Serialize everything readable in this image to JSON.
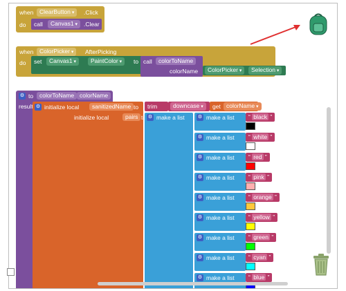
{
  "clear_event": {
    "when": "when",
    "component": "ClearButton",
    "event": ".Click",
    "do": "do",
    "call": "call",
    "target": "Canvas1",
    "method": ".Clear"
  },
  "picker_event": {
    "when": "when",
    "component": "ColorPicker",
    "event": "AfterPicking",
    "do": "do",
    "set": "set",
    "target": "Canvas1",
    "property": "PaintColor",
    "to": "to",
    "call": "call",
    "proc": "colorToName",
    "param": "colorName",
    "source": "ColorPicker",
    "source_prop": "Selection"
  },
  "proc": {
    "to": "to",
    "name": "colorToName",
    "arg": "colorName",
    "result": "result"
  },
  "init1": {
    "label": "initialize local",
    "var": "sanitizedName",
    "to": "to",
    "trim": "trim",
    "case": "downcase",
    "get": "get",
    "get_var": "colorName"
  },
  "init2": {
    "label": "initialize local",
    "var": "pairs",
    "to": "to"
  },
  "list": {
    "make_a_list": "make a list"
  },
  "colors": [
    {
      "name": "black",
      "hex": "#000000"
    },
    {
      "name": "white",
      "hex": "#ffffff"
    },
    {
      "name": "red",
      "hex": "#ff0000"
    },
    {
      "name": "pink",
      "hex": "#ffafaf"
    },
    {
      "name": "orange",
      "hex": "#ffc83c"
    },
    {
      "name": "yellow",
      "hex": "#ffff00"
    },
    {
      "name": "green",
      "hex": "#00ff00"
    },
    {
      "name": "cyan",
      "hex": "#00ffff"
    },
    {
      "name": "blue",
      "hex": "#0000ff"
    }
  ]
}
